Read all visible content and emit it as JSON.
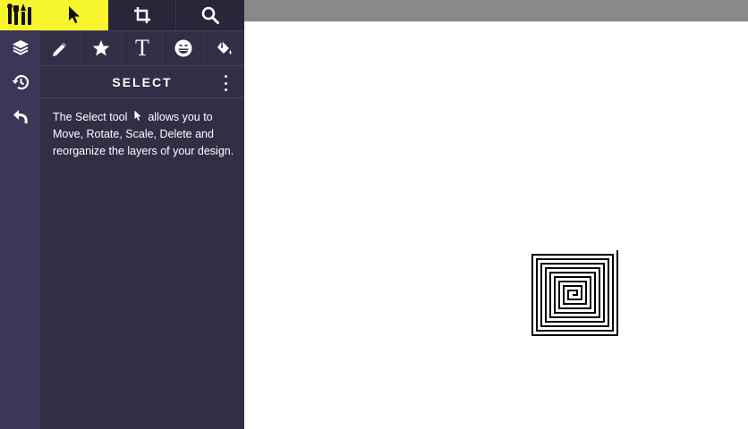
{
  "app": {
    "accent_color": "#f7f52d",
    "rail_color": "#3d3656",
    "panel_color": "#332d45"
  },
  "left_rail": {
    "logo_icon": "tools-logo-icon",
    "items": [
      {
        "name": "layers",
        "icon": "layers-icon"
      },
      {
        "name": "history",
        "icon": "history-icon"
      },
      {
        "name": "undo",
        "icon": "undo-icon"
      }
    ]
  },
  "top_tabs": [
    {
      "name": "select",
      "icon": "cursor-icon",
      "active": true
    },
    {
      "name": "crop",
      "icon": "crop-icon",
      "active": false
    },
    {
      "name": "zoom",
      "icon": "search-icon",
      "active": false
    }
  ],
  "tools": [
    {
      "name": "pencil",
      "icon": "pencil-icon"
    },
    {
      "name": "shape",
      "icon": "star-icon"
    },
    {
      "name": "text",
      "icon": "text-icon",
      "glyph": "T"
    },
    {
      "name": "emoji",
      "icon": "grin-emoji-icon"
    },
    {
      "name": "fill",
      "icon": "paint-bucket-icon"
    }
  ],
  "panel": {
    "title": "SELECT",
    "description_part1": "The Select tool",
    "description_part2": "allows you to",
    "description_line2": "Move, Rotate, Scale, Delete and",
    "description_line3": "reorganize the layers of your design."
  },
  "canvas": {
    "artwork": "square spiral",
    "artwork_color": "#000000"
  }
}
